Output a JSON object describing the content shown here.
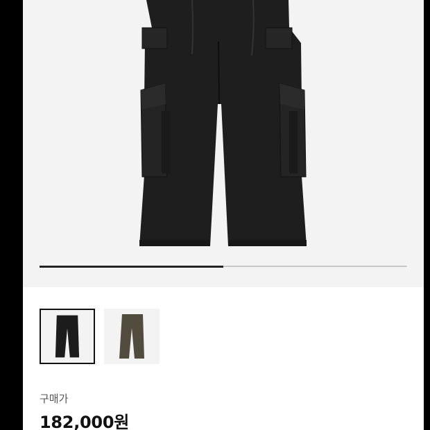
{
  "product": {
    "gallery": {
      "progress_fraction": 0.5,
      "thumbnails": [
        {
          "name": "black",
          "color": "#1c1c1c",
          "selected": true
        },
        {
          "name": "olive",
          "color": "#514c3d",
          "selected": false
        }
      ]
    },
    "price_label": "구매가",
    "price": "182,000원"
  },
  "colors": {
    "hero_bg": "#f3f3f3",
    "pants_black": "#1e1e1e",
    "pants_olive": "#514c3d"
  }
}
